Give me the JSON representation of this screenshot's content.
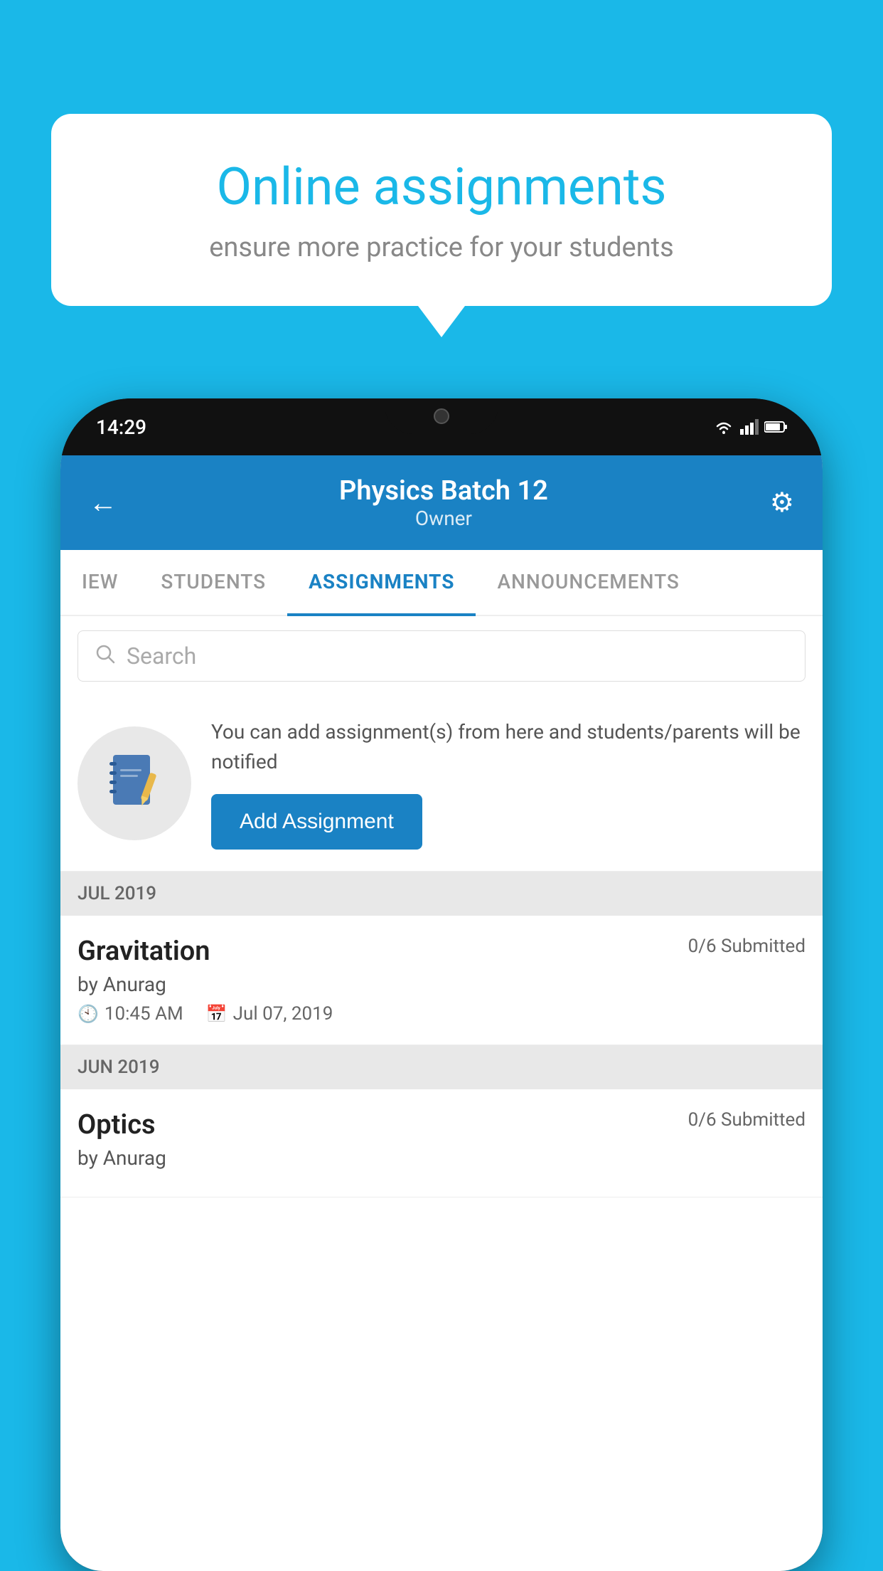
{
  "background_color": "#1ab8e8",
  "speech_bubble": {
    "title": "Online assignments",
    "subtitle": "ensure more practice for your students"
  },
  "phone": {
    "status_bar": {
      "time": "14:29"
    },
    "header": {
      "title": "Physics Batch 12",
      "subtitle": "Owner",
      "back_label": "←",
      "settings_label": "⚙"
    },
    "tabs": [
      {
        "label": "IEW",
        "active": false
      },
      {
        "label": "STUDENTS",
        "active": false
      },
      {
        "label": "ASSIGNMENTS",
        "active": true
      },
      {
        "label": "ANNOUNCEMENTS",
        "active": false
      }
    ],
    "search": {
      "placeholder": "Search"
    },
    "info_card": {
      "description": "You can add assignment(s) from here and students/parents will be notified",
      "button_label": "Add Assignment"
    },
    "sections": [
      {
        "label": "JUL 2019",
        "assignments": [
          {
            "name": "Gravitation",
            "submitted": "0/6 Submitted",
            "by": "by Anurag",
            "time": "10:45 AM",
            "date": "Jul 07, 2019"
          }
        ]
      },
      {
        "label": "JUN 2019",
        "assignments": [
          {
            "name": "Optics",
            "submitted": "0/6 Submitted",
            "by": "by Anurag",
            "time": "",
            "date": ""
          }
        ]
      }
    ]
  }
}
